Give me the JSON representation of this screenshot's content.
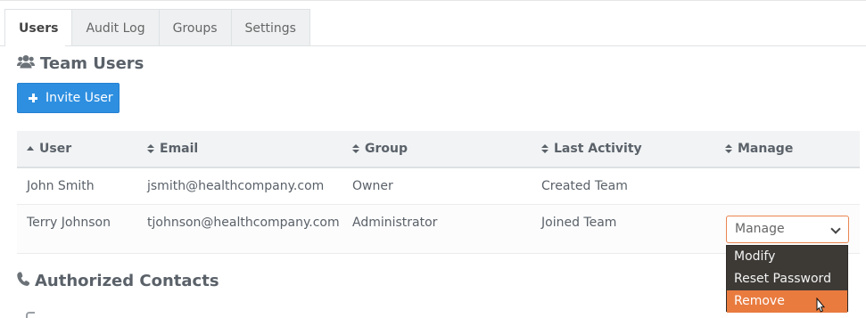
{
  "tabs": [
    {
      "label": "Users",
      "active": true
    },
    {
      "label": "Audit Log",
      "active": false
    },
    {
      "label": "Groups",
      "active": false
    },
    {
      "label": "Settings",
      "active": false
    }
  ],
  "team_users": {
    "title": "Team Users",
    "icon": "users-icon",
    "invite_button": {
      "label": "Invite User",
      "icon": "plus-icon"
    }
  },
  "table": {
    "columns": [
      {
        "label": "User",
        "sort": "ascending"
      },
      {
        "label": "Email",
        "sort": "both"
      },
      {
        "label": "Group",
        "sort": "both"
      },
      {
        "label": "Last Activity",
        "sort": "both"
      },
      {
        "label": "Manage",
        "sort": "both"
      }
    ],
    "rows": [
      {
        "user": "John Smith",
        "email": "jsmith@healthcompany.com",
        "group": "Owner",
        "last_activity": "Created Team"
      },
      {
        "user": "Terry Johnson",
        "email": "tjohnson@healthcompany.com",
        "group": "Administrator",
        "last_activity": "Joined Team"
      }
    ]
  },
  "manage_select": {
    "value": "Manage",
    "options": [
      "Modify",
      "Reset Password",
      "Remove"
    ],
    "highlighted": "Remove",
    "accent_color": "#e97b3f"
  },
  "authorized_contacts": {
    "title": "Authorized Contacts",
    "icon": "phone-icon"
  },
  "colors": {
    "primary_button": "#2e8fe0",
    "dropdown_bg": "#3d3a36"
  }
}
